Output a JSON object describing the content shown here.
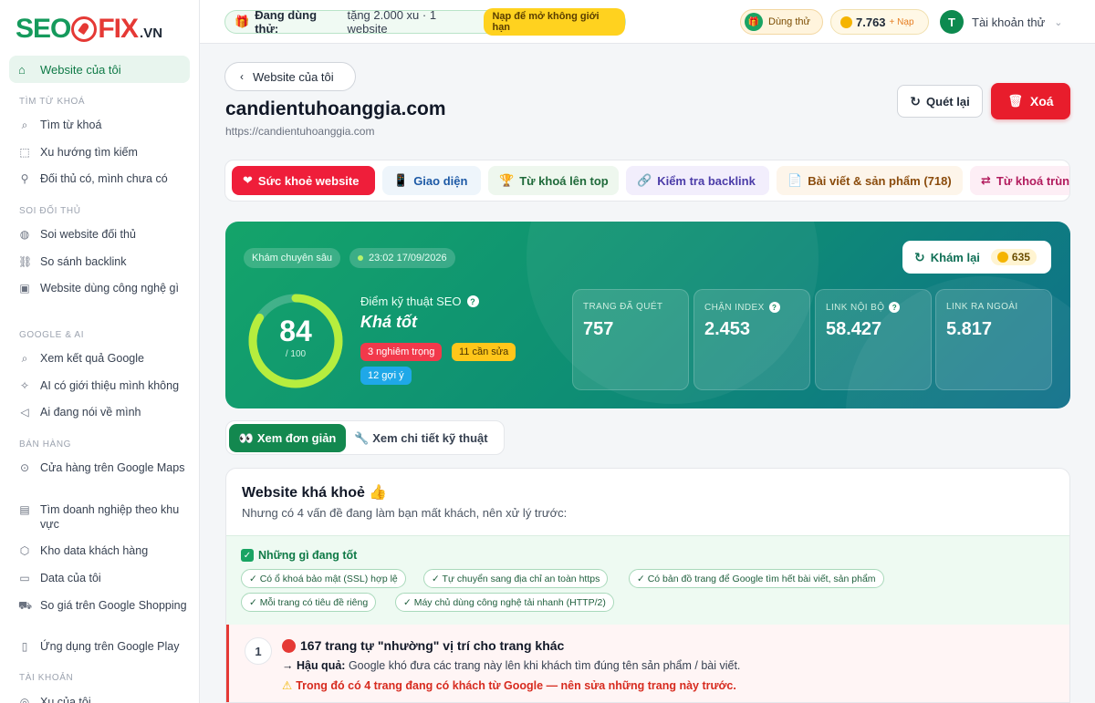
{
  "brand": {
    "seo": "SEO",
    "fix": "FIX",
    "vn": ".VN"
  },
  "sidebar": {
    "active": {
      "label": "Website của tôi",
      "icon": "home-icon"
    },
    "sections": [
      {
        "title": "TÌM TỪ KHOÁ",
        "items": [
          {
            "label": "Tìm từ khoá",
            "icon": "search-icon"
          },
          {
            "label": "Xu hướng tìm kiếm",
            "icon": "trend-icon"
          },
          {
            "label": "Đối thủ có, mình chưa có",
            "icon": "compare-icon"
          }
        ]
      },
      {
        "title": "SOI ĐỐI THỦ",
        "items": [
          {
            "label": "Soi website đối thủ",
            "icon": "globe-icon"
          },
          {
            "label": "So sánh backlink",
            "icon": "link-icon"
          },
          {
            "label": "Website dùng công nghệ gì",
            "icon": "chip-icon"
          }
        ]
      },
      {
        "title": "GOOGLE & AI",
        "items": [
          {
            "label": "Xem kết quả Google",
            "icon": "search-icon"
          },
          {
            "label": "AI có giới thiệu mình không",
            "icon": "sparkle-icon"
          },
          {
            "label": "Ai đang nói về mình",
            "icon": "megaphone-icon"
          }
        ]
      },
      {
        "title": "BÁN HÀNG",
        "items": [
          {
            "label": "Cửa hàng trên Google Maps",
            "icon": "map-pin-icon"
          },
          {
            "label": "Tìm doanh nghiệp theo khu vực",
            "icon": "building-icon"
          },
          {
            "label": "Kho data khách hàng",
            "icon": "box-icon"
          },
          {
            "label": "Data của tôi",
            "icon": "database-icon"
          },
          {
            "label": "So giá trên Google Shopping",
            "icon": "cart-icon"
          },
          {
            "label": "Ứng dụng trên Google Play",
            "icon": "app-icon"
          }
        ]
      },
      {
        "title": "TÀI KHOẢN",
        "items": [
          {
            "label": "Xu của tôi",
            "icon": "coin-icon"
          }
        ]
      }
    ]
  },
  "topbar": {
    "trial_prefix": "Đang dùng thử:",
    "trial_text": "tặng 2.000 xu · 1 website",
    "trial_cta": "Nạp để mở không giới hạn",
    "try_label": "Dùng thử",
    "coins": "7.763",
    "topup": "+ Nạp",
    "avatar_letter": "T",
    "account": "Tài khoản thử"
  },
  "page": {
    "back_label": "Website của tôi",
    "domain": "candientuhoanggia.com",
    "url": "https://candientuhoanggia.com",
    "rescan_label": "Quét lại",
    "delete_label": "Xoá"
  },
  "tabs": [
    {
      "label": "Sức khoẻ website",
      "icon": "heart-icon"
    },
    {
      "label": "Giao diện",
      "icon": "phone-icon"
    },
    {
      "label": "Từ khoá lên top",
      "icon": "trophy-icon"
    },
    {
      "label": "Kiểm tra backlink",
      "icon": "link-icon"
    },
    {
      "label": "Bài viết & sản phẩm (718)",
      "icon": "document-icon"
    },
    {
      "label": "Từ khoá trùn",
      "icon": "swap-icon"
    }
  ],
  "hero": {
    "chip_deep": "Khám chuyên sâu",
    "chip_time": "23:02 17/09/2026",
    "score": "84",
    "score_max": "/ 100",
    "score_value": 0.84,
    "seo_label": "Điểm kỹ thuật SEO",
    "seo_rating": "Khá tốt",
    "tags": [
      "3 nghiêm trọng",
      "11 cần sửa",
      "12 gợi ý"
    ],
    "rescan_label": "Khám lại",
    "rescan_cost": "635",
    "stats": [
      {
        "label": "TRANG ĐÃ QUÉT",
        "value": "757",
        "help": false
      },
      {
        "label": "CHẶN INDEX",
        "value": "2.453",
        "help": true
      },
      {
        "label": "LINK NỘI BỘ",
        "value": "58.427",
        "help": true
      },
      {
        "label": "LINK RA NGOÀI",
        "value": "5.817",
        "help": false
      }
    ]
  },
  "view": {
    "simple": "Xem đơn giản",
    "detail": "Xem chi tiết kỹ thuật"
  },
  "summary": {
    "title": "Website khá khoẻ 👍",
    "subtitle": "Nhưng có 4 vấn đề đang làm bạn mất khách, nên xử lý trước:",
    "good_title": "Những gì đang tốt",
    "good_items": [
      "✓ Có ổ khoá bảo mật (SSL) hợp lệ",
      "✓ Tự chuyển sang địa chỉ an toàn https",
      "✓ Có bản đồ trang để Google tìm hết bài viết, sản phẩm",
      "✓ Mỗi trang có tiêu đề riêng",
      "✓ Máy chủ dùng công nghệ tải nhanh (HTTP/2)"
    ]
  },
  "issue": {
    "num": "1",
    "title": "167 trang tự \"nhường\" vị trí cho trang khác",
    "consequence_label": "→ Hậu quả:",
    "consequence": "Google khó đưa các trang này lên khi khách tìm đúng tên sản phẩm / bài viết.",
    "warning": "Trong đó có 4 trang đang có khách từ Google — nên sửa những trang này trước."
  }
}
